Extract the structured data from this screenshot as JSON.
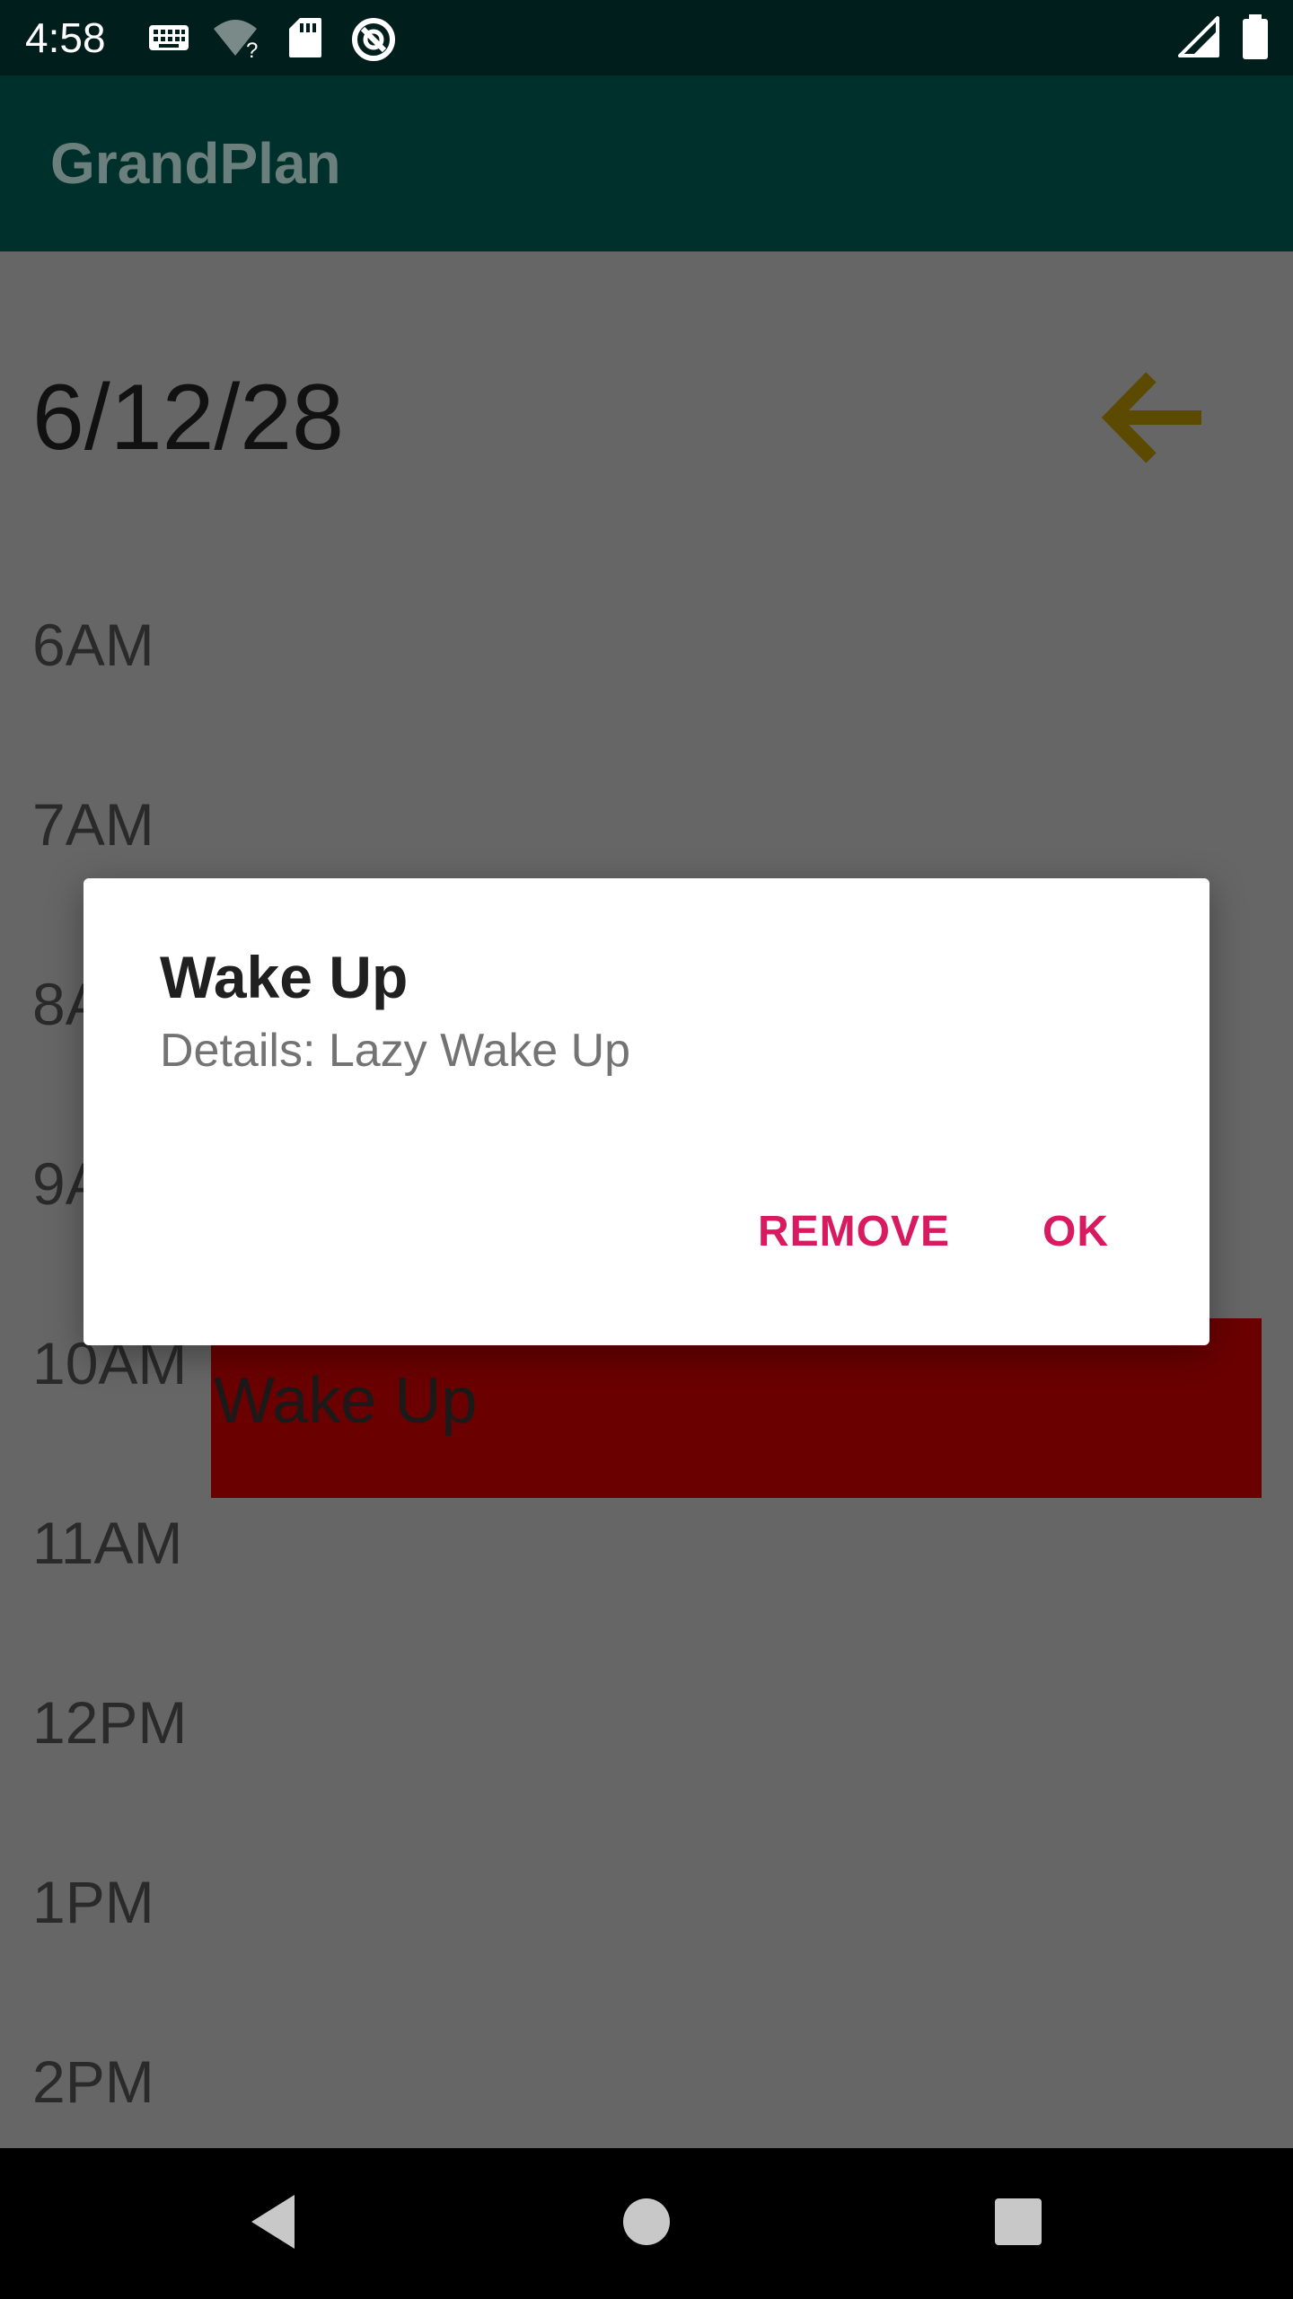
{
  "status_bar": {
    "time": "4:58",
    "icons": [
      "keyboard-icon",
      "wifi-unknown-icon",
      "sd-card-icon",
      "data-saver-icon",
      "cell-signal-icon",
      "battery-icon"
    ]
  },
  "app_bar": {
    "title": "GrandPlan"
  },
  "schedule": {
    "date": "6/12/28",
    "back_icon": "arrow-left-icon",
    "hours": [
      "6AM",
      "7AM",
      "8AM",
      "9AM",
      "10AM",
      "11AM",
      "12PM",
      "1PM",
      "2PM"
    ],
    "event": {
      "label": "Wake Up",
      "color": "#6b0000"
    }
  },
  "dialog": {
    "title": "Wake Up",
    "message": "Details: Lazy Wake Up",
    "remove_label": "REMOVE",
    "ok_label": "OK",
    "button_color": "#d81b60"
  },
  "nav_bar": {
    "icons": [
      "back-icon",
      "home-icon",
      "recents-icon"
    ]
  },
  "colors": {
    "app_bar": "#00302c",
    "status_bar": "#001f1c",
    "scrim": "#666666",
    "back_arrow": "#5c4a00"
  }
}
